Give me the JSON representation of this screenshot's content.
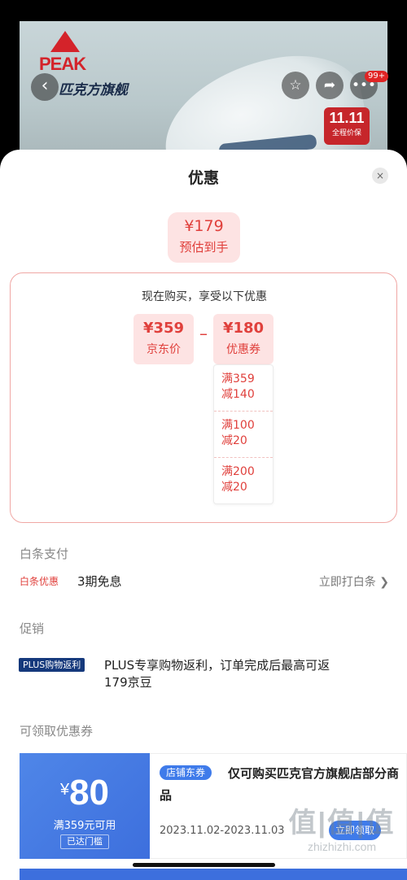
{
  "store": {
    "brand_logo_text": "PEAK",
    "name": "匹克方旗舰",
    "notification_count": "99+",
    "promo_tag_big": "11.11",
    "promo_tag_small": "全程价保"
  },
  "sheet": {
    "title": "优惠",
    "close_icon": "×"
  },
  "final_price": {
    "value": "¥179",
    "label": "预估到手"
  },
  "breakdown": {
    "heading": "现在购买，享受以下优惠",
    "jd_price": {
      "value": "¥359",
      "label": "京东价"
    },
    "operator": "–",
    "coupon_total": {
      "value": "¥180",
      "label": "优惠券"
    },
    "coupons": [
      {
        "line1": "满359",
        "line2": "减140"
      },
      {
        "line1": "满100",
        "line2": "减20"
      },
      {
        "line1": "满200",
        "line2": "减20"
      }
    ]
  },
  "baitiao": {
    "section": "白条支付",
    "tag": "白条优惠",
    "text": "3期免息",
    "link": "立即打白条 ❯"
  },
  "promotion": {
    "section": "促销",
    "tag": "PLUS购物返利",
    "text_line1": "PLUS专享购物返利，订单完成后最高可返",
    "text_line2": "179京豆"
  },
  "coupons_section": {
    "section": "可领取优惠券",
    "card": {
      "currency": "¥",
      "amount": "80",
      "condition": "满359元可用",
      "status": "已达门槛",
      "shop_tag": "店铺东券",
      "description": "仅可购买匹克官方旗舰店部分商品",
      "date_range": "2023.11.02-2023.11.03",
      "claim_label": "立即领取"
    }
  },
  "watermark": {
    "big": "值|值|值",
    "small": "zhizhizhi.com"
  },
  "colors": {
    "accent_red": "#e0403c",
    "coupon_blue": "#3f7bea",
    "plus_navy": "#15397c"
  }
}
